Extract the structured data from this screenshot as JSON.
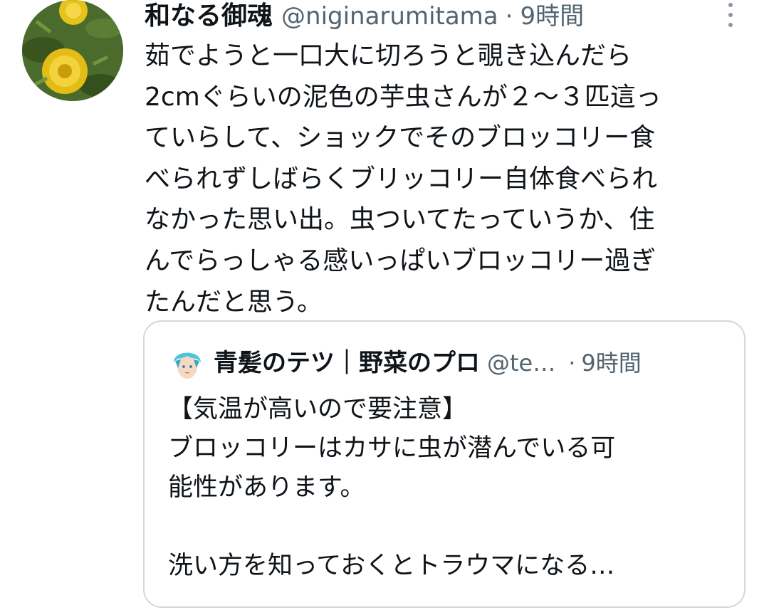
{
  "tweet": {
    "author": {
      "display_name": "和なる御魂",
      "handle": "@niginarumitama",
      "avatar_icon": "flower-avatar-icon"
    },
    "separator": "·",
    "time": "9時間",
    "more_icon": "more-options-icon",
    "text_lines": [
      "茹でようと一口大に切ろうと覗き込んだら",
      "2cmぐらいの泥色の芋虫さんが２〜３匹這っ",
      "ていらして、ショックでそのブロッコリー食",
      "べられずしばらくブリッコリー自体食べられ",
      "なかった思い出。虫ついてたっていうか、住",
      "んでらっしゃる感いっぱいブロッコリー過ぎ",
      "たんだと思う。"
    ]
  },
  "quoted_tweet": {
    "author": {
      "display_name": "青髪のテツ｜野菜のプロ",
      "handle": "@te…",
      "avatar_icon": "blue-hair-avatar-icon"
    },
    "separator": "·",
    "time": "9時間",
    "text_lines": [
      "【気温が高いので要注意】",
      "ブロッコリーはカサに虫が潜んでいる可",
      "能性があります。",
      "",
      "洗い方を知っておくとトラウマになる…"
    ]
  },
  "colors": {
    "text_primary": "#0f1419",
    "text_secondary": "#536471",
    "border": "#cfd9de",
    "background": "#ffffff"
  }
}
